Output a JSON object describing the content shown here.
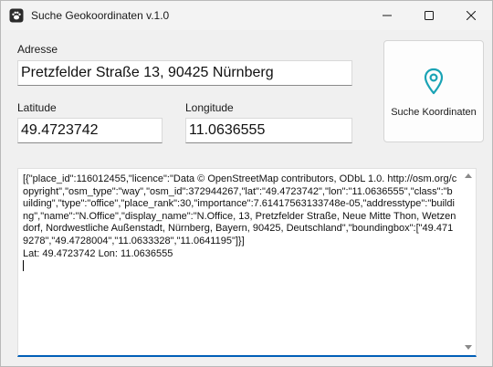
{
  "window": {
    "title": "Suche Geokoordinaten v.1.0",
    "icon": "paw-icon"
  },
  "address": {
    "label": "Adresse",
    "value": "Pretzfelder Straße 13, 90425 Nürnberg"
  },
  "latitude": {
    "label": "Latitude",
    "value": "49.4723742"
  },
  "longitude": {
    "label": "Longitude",
    "value": "11.0636555"
  },
  "search_button": {
    "label": "Suche Koordinaten",
    "icon": "map-pin-icon",
    "accent": "#1aa3b5"
  },
  "output": {
    "text": "[{\"place_id\":116012455,\"licence\":\"Data © OpenStreetMap contributors, ODbL 1.0. http://osm.org/copyright\",\"osm_type\":\"way\",\"osm_id\":372944267,\"lat\":\"49.4723742\",\"lon\":\"11.0636555\",\"class\":\"building\",\"type\":\"office\",\"place_rank\":30,\"importance\":7.61417563133748e-05,\"addresstype\":\"building\",\"name\":\"N.Office\",\"display_name\":\"N.Office, 13, Pretzfelder Straße, Neue Mitte Thon, Wetzendorf, Nordwestliche Außenstadt, Nürnberg, Bayern, 90425, Deutschland\",\"boundingbox\":[\"49.4719278\",\"49.4728004\",\"11.0633328\",\"11.0641195\"]}]\nLat: 49.4723742 Lon: 11.0636555\n",
    "focus_accent": "#005fb8"
  }
}
